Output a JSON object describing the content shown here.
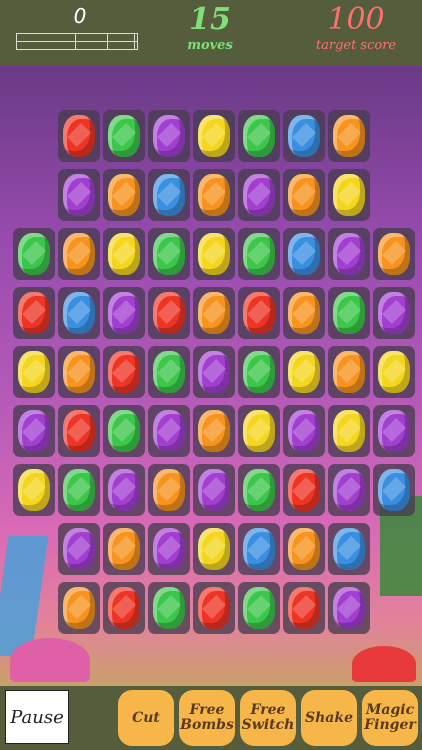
{
  "hud": {
    "score": "0",
    "score_progress": 0,
    "moves": "15",
    "moves_label": "moves",
    "target": "100",
    "target_label": "target score"
  },
  "board": {
    "rows": [
      [
        null,
        "red",
        "green",
        "purple",
        "yellow",
        "green",
        "blue",
        "orange",
        null
      ],
      [
        null,
        "purple",
        "orange",
        "blue",
        "orange",
        "purple",
        "orange",
        "yellow",
        null
      ],
      [
        "green",
        "orange",
        "yellow",
        "green",
        "yellow",
        "green",
        "blue",
        "purple",
        "orange"
      ],
      [
        "red",
        "blue",
        "purple",
        "red",
        "orange",
        "red",
        "orange",
        "green",
        "purple"
      ],
      [
        "yellow",
        "orange",
        "red",
        "green",
        "purple",
        "green",
        "yellow",
        "orange",
        "yellow"
      ],
      [
        "purple",
        "red",
        "green",
        "purple",
        "orange",
        "yellow",
        "purple",
        "yellow",
        "purple"
      ],
      [
        "yellow",
        "green",
        "purple",
        "orange",
        "purple",
        "green",
        "red",
        "purple",
        "blue"
      ],
      [
        null,
        "purple",
        "orange",
        "purple",
        "yellow",
        "blue",
        "orange",
        "blue",
        null
      ],
      [
        null,
        "orange",
        "red",
        "green",
        "red",
        "green",
        "red",
        "purple",
        null
      ]
    ]
  },
  "bottombar": {
    "pause": "Pause",
    "cut": "Cut",
    "free_bombs": "Free Bombs",
    "free_switch": "Free Switch",
    "shake": "Shake",
    "magic_finger": "Magic Finger"
  },
  "colors": {
    "bar": "#555d3c",
    "moves": "#7fe07a",
    "target": "#ff6f6f",
    "powerup": "#f6b64a"
  }
}
